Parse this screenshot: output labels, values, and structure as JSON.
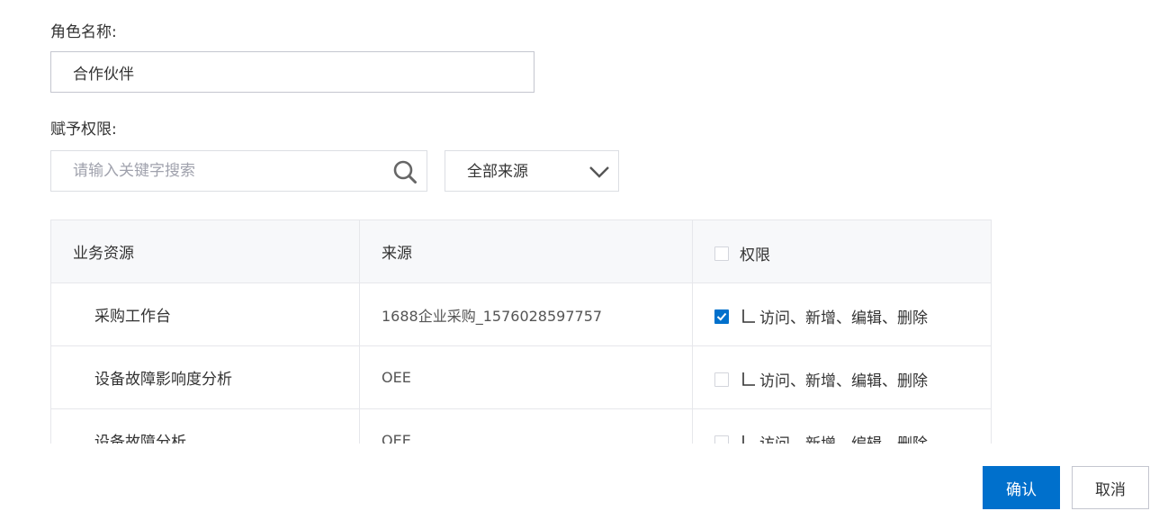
{
  "form": {
    "role_label": "角色名称:",
    "role_value": "合作伙伴",
    "perm_label": "赋予权限:"
  },
  "filter": {
    "search_placeholder": "请输入关键字搜索",
    "source_selected": "全部来源"
  },
  "table": {
    "headers": {
      "resource": "业务资源",
      "source": "来源",
      "permission": "权限"
    },
    "rows": [
      {
        "resource": "采购工作台",
        "source": "1688企业采购_1576028597757",
        "permission": "访问、新增、编辑、删除",
        "checked": true
      },
      {
        "resource": "设备故障影响度分析",
        "source": "OEE",
        "permission": "访问、新增、编辑、删除",
        "checked": false
      },
      {
        "resource": "设备故障分析",
        "source": "OEE",
        "permission": "访问、新增、编辑、删除",
        "checked": false
      }
    ]
  },
  "actions": {
    "confirm": "确认",
    "cancel": "取消"
  },
  "colors": {
    "primary": "#0070cc",
    "border": "#e6e7eb",
    "header_bg": "#f7f8fa"
  },
  "icons": {
    "search": "search-icon",
    "dropdown": "chevron-down-icon",
    "check": "check-icon",
    "tree": "tree-branch-icon"
  }
}
